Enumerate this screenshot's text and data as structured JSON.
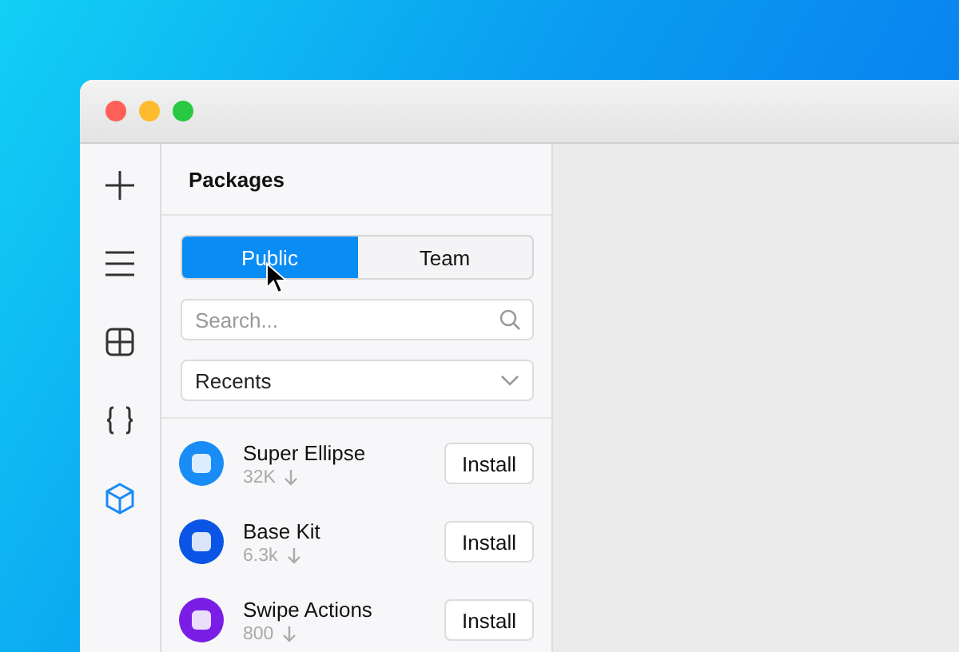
{
  "rail": [
    {
      "kind": "plus",
      "selected": false
    },
    {
      "kind": "menu",
      "selected": false
    },
    {
      "kind": "grid",
      "selected": false
    },
    {
      "kind": "braces",
      "selected": false
    },
    {
      "kind": "cube",
      "selected": true
    }
  ],
  "panel": {
    "title": "Packages",
    "tabs": [
      {
        "label": "Public",
        "selected": true
      },
      {
        "label": "Team",
        "selected": false
      }
    ],
    "search": {
      "placeholder": "Search..."
    },
    "filter": {
      "value": "Recents"
    },
    "packages": [
      {
        "name": "Super Ellipse",
        "downloads": "32K",
        "color": "#1a8cf5",
        "button": "Install"
      },
      {
        "name": "Base Kit",
        "downloads": "6.3k",
        "color": "#0a55e6",
        "button": "Install"
      },
      {
        "name": "Swipe Actions",
        "downloads": "800",
        "color": "#7a1ee6",
        "button": "Install"
      }
    ]
  }
}
